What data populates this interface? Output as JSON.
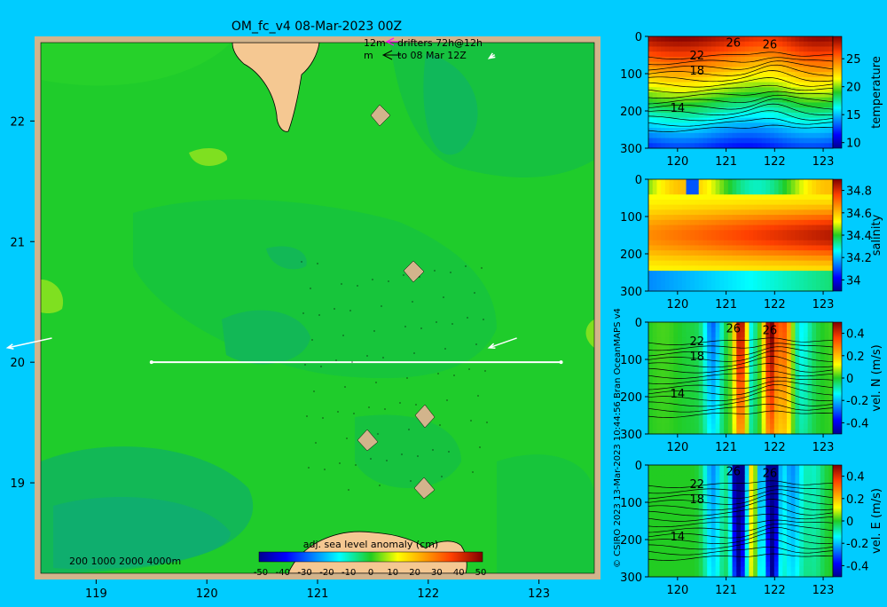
{
  "page": {
    "title": "OM_fc_v4  08-Mar-2023 00Z",
    "credit": "© CSIRO 2023  13-Mar-2023 10:44:56 Bran OceanMAPS v4",
    "background": "#00ccff"
  },
  "map": {
    "drifters_line1_left": "12m",
    "drifters_line1_right": "drifters 72h@12h",
    "drifters_line2_left": "m",
    "drifters_line2_right": "to 08 Mar 12Z",
    "depth_legend": "200  1000  2000  4000m",
    "colorbar_label": "adj. sea level anomaly (cm)",
    "colorbar_ticks": [
      "-50",
      "-40",
      "-30",
      "-20",
      "-10",
      "0",
      "10",
      "20",
      "30",
      "40",
      "50"
    ],
    "xticks": [
      "119",
      "120",
      "121",
      "122",
      "123"
    ],
    "yticks": [
      "22",
      "21",
      "20",
      "19"
    ],
    "x_range": [
      118.5,
      123.5
    ],
    "y_range": [
      18.25,
      22.65
    ]
  },
  "chart_data": [
    {
      "type": "heatmap",
      "title": "adj. sea level anomaly (cm)",
      "x_range": [
        118.5,
        123.5
      ],
      "y_range": [
        18.25,
        22.65
      ],
      "color_range": [
        -50,
        50
      ],
      "transect": {
        "lon": [
          119.5,
          123.2
        ],
        "lat": [
          20.0,
          20.0
        ]
      },
      "drifter_arrows": [
        {
          "from": [
            118.6,
            20.2
          ],
          "to": [
            118.2,
            20.12
          ]
        },
        {
          "from": [
            122.8,
            20.2
          ],
          "to": [
            122.55,
            20.12
          ]
        },
        {
          "from": [
            122.6,
            22.55
          ],
          "to": [
            122.55,
            22.52
          ]
        }
      ]
    },
    {
      "type": "heatmap",
      "ylabel": "temperature",
      "x_ticks": [
        "120",
        "121",
        "122",
        "123"
      ],
      "y_ticks": [
        "0",
        "100",
        "200",
        "300"
      ],
      "colorbar_ticks": [
        "25",
        "20",
        "15",
        "10"
      ],
      "contour_labels": [
        "26",
        "26",
        "22",
        "18",
        "14"
      ],
      "x_range": [
        119.4,
        123.2
      ],
      "y_range": [
        0,
        300
      ],
      "color_range": [
        9,
        29
      ]
    },
    {
      "type": "heatmap",
      "ylabel": "salinity",
      "x_ticks": [
        "120",
        "121",
        "122",
        "123"
      ],
      "y_ticks": [
        "0",
        "100",
        "200",
        "300"
      ],
      "colorbar_ticks": [
        "34.8",
        "34.6",
        "34.4",
        "34.2",
        "34"
      ],
      "x_range": [
        119.4,
        123.2
      ],
      "y_range": [
        0,
        300
      ],
      "color_range": [
        33.9,
        34.9
      ]
    },
    {
      "type": "heatmap",
      "ylabel": "vel. N (m/s)",
      "x_ticks": [
        "120",
        "121",
        "122",
        "123"
      ],
      "y_ticks": [
        "0",
        "100",
        "200",
        "300"
      ],
      "colorbar_ticks": [
        "0.4",
        "0.2",
        "0",
        "-0.2",
        "-0.4"
      ],
      "contour_labels": [
        "26",
        "26",
        "22",
        "18",
        "14"
      ],
      "x_range": [
        119.4,
        123.2
      ],
      "y_range": [
        0,
        300
      ],
      "color_range": [
        -0.5,
        0.5
      ]
    },
    {
      "type": "heatmap",
      "ylabel": "vel. E (m/s)",
      "x_ticks": [
        "120",
        "121",
        "122",
        "123"
      ],
      "y_ticks": [
        "0",
        "100",
        "200",
        "300"
      ],
      "colorbar_ticks": [
        "0.4",
        "0.2",
        "0",
        "-0.2",
        "-0.4"
      ],
      "contour_labels": [
        "26",
        "26",
        "22",
        "18",
        "14"
      ],
      "x_range": [
        119.4,
        123.2
      ],
      "y_range": [
        0,
        300
      ],
      "color_range": [
        -0.5,
        0.5
      ]
    }
  ]
}
